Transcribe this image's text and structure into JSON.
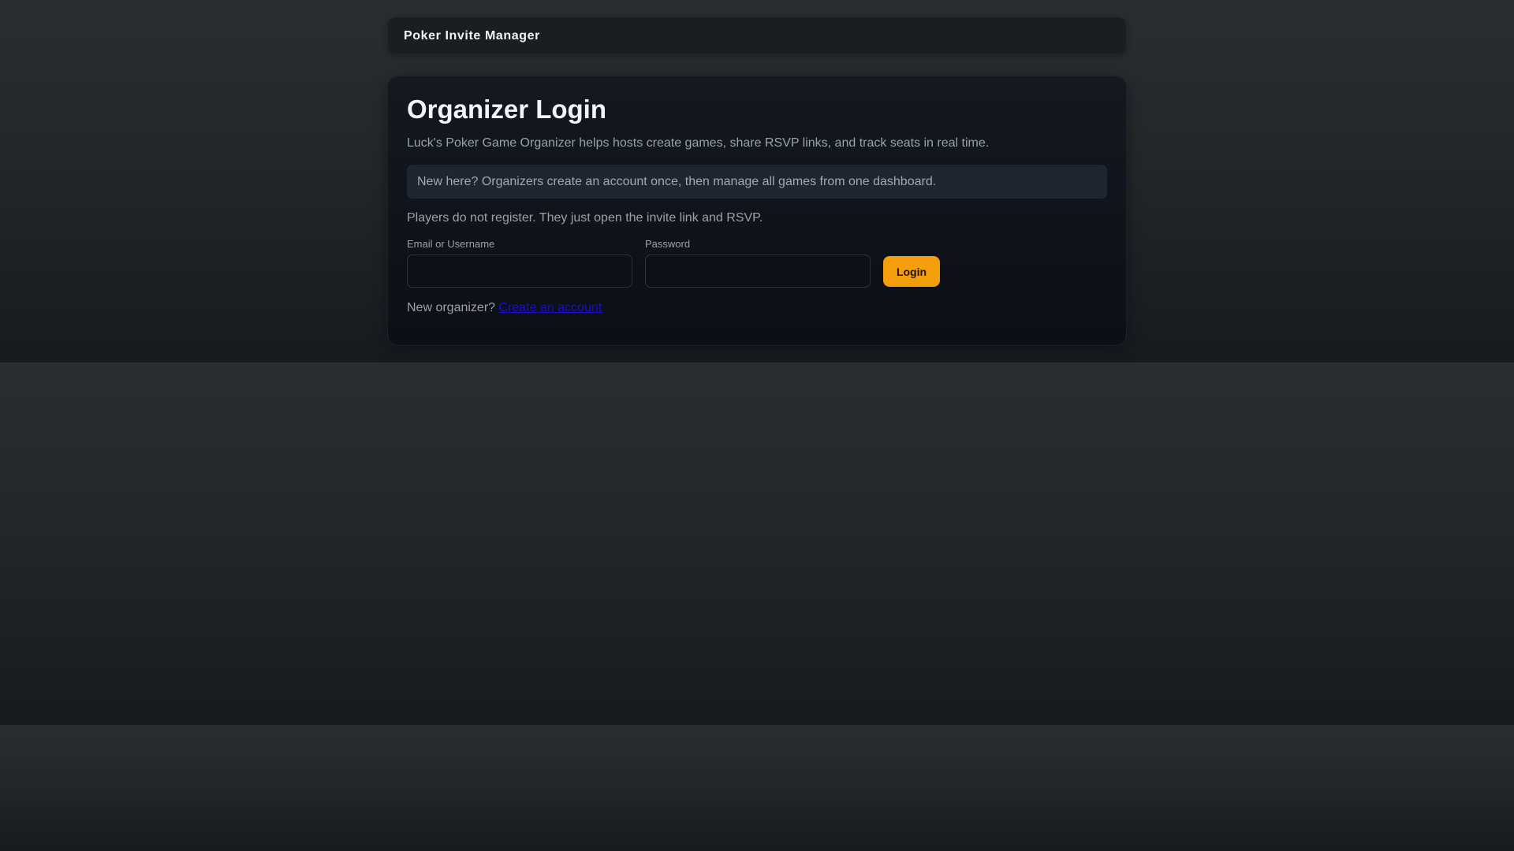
{
  "header": {
    "brand": "Poker Invite Manager"
  },
  "login": {
    "title": "Organizer Login",
    "description": "Luck's Poker Game Organizer helps hosts create games, share RSVP links, and track seats in real time.",
    "notice": "New here? Organizers create an account once, then manage all games from one dashboard.",
    "players_note": "Players do not register. They just open the invite link and RSVP.",
    "fields": {
      "username_label": "Email or Username",
      "username_value": "",
      "password_label": "Password",
      "password_value": ""
    },
    "login_button": "Login",
    "register_prompt": "New organizer?",
    "register_link": "Create an account"
  },
  "colors": {
    "accent": "#f59e0b",
    "link": "#1a0dcc",
    "background": "#292c30",
    "card": "#11151c"
  }
}
